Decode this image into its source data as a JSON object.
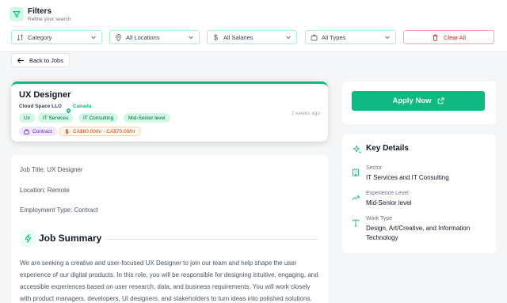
{
  "filters": {
    "title": "Filters",
    "subtitle": "Refine your search",
    "selects": [
      {
        "label": "Category",
        "icon": "sort-icon"
      },
      {
        "label": "All Locations",
        "icon": "map-pin-icon"
      },
      {
        "label": "All Salaries",
        "icon": "dollar-icon"
      },
      {
        "label": "All Types",
        "icon": "briefcase-icon"
      }
    ],
    "clear_label": "Clear All"
  },
  "back_label": "Back to Jobs",
  "job": {
    "title": "UX Designer",
    "company": "Cloud Space LLC",
    "separator": "•",
    "location": "Canada",
    "posted": "2 weeks ago",
    "tags": [
      "Ux",
      "IT Services",
      "IT Consulting",
      "Mid-Senior level"
    ],
    "type": "Contract",
    "salary": "CA$60.00/hr - CA$70.00/hr"
  },
  "description": {
    "job_title_line": "Job Title: UX Designer",
    "location_line": "Location: Remote",
    "employment_line": "Employment Type: Contract",
    "summary_heading": "Job Summary",
    "summary_text": "We are seeking a creative and user-focused UX Designer to join our team and help shape the user experience of our digital products. In this role, you will be responsible for designing intuitive, engaging, and accessible experiences based on user research, data, and business requirements. You will work closely with product managers, developers, UI designers, and stakeholders to turn ideas into polished solutions."
  },
  "apply_label": "Apply Now",
  "key_details": {
    "heading": "Key Details",
    "items": [
      {
        "label": "Sector",
        "value": "IT Services and IT Consulting"
      },
      {
        "label": "Experience Level",
        "value": "Mid-Senior level"
      },
      {
        "label": "Work Type",
        "value": "Design, Art/Creative, and Information Technology"
      }
    ]
  },
  "colors": {
    "accent": "#10b981",
    "danger": "#dc2626",
    "background": "#f5f6f7"
  }
}
